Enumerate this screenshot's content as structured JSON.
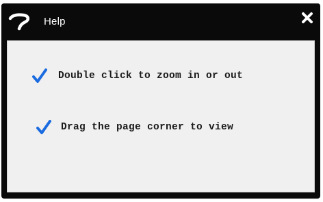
{
  "window": {
    "title": "Help",
    "icons": {
      "help": "question-mark-icon",
      "close": "close-icon"
    }
  },
  "tips": [
    {
      "text": "Double click to zoom in or out",
      "icon": "checkmark-icon"
    },
    {
      "text": "Drag the page corner to view",
      "icon": "checkmark-icon"
    }
  ],
  "colors": {
    "title_bar": "#0a0a0a",
    "title_text": "#ffffff",
    "content_bg": "#f0f0f0",
    "check": "#1a6be0",
    "text": "#1a1a1a"
  }
}
